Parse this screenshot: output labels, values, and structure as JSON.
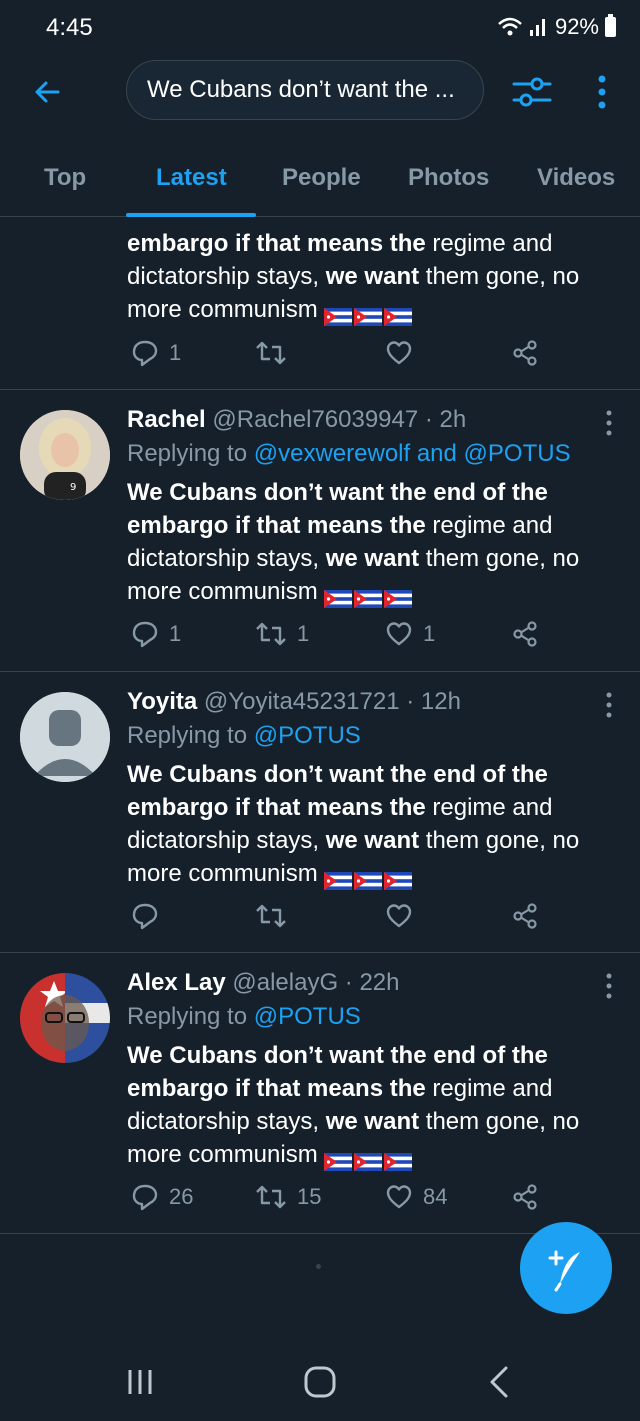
{
  "status_bar": {
    "time": "4:45",
    "battery": "92%"
  },
  "search": {
    "query": "We Cubans don’t want the ..."
  },
  "tabs": [
    "Top",
    "Latest",
    "People",
    "Photos",
    "Videos"
  ],
  "active_tab": "Latest",
  "partial_tweet": {
    "line1_bold": "embargo if that means the",
    "line1_rest": " regime and",
    "line2_a": "dictatorship stays, ",
    "line2_bold": "we want",
    "line2_rest": " them gone, no",
    "line3": "more communism",
    "replies": "1",
    "retweets": "",
    "likes": ""
  },
  "tweets": [
    {
      "name": "Rachel",
      "meta": "@Rachel76039947 · 2h",
      "replying_prefix": "Replying to ",
      "replying_to": "@vexwerewolf and @POTUS",
      "text_l1": "We Cubans don’t want the end of the",
      "text_l2_bold": "embargo if that means the",
      "text_l2_rest": " regime and",
      "text_l3_a": "dictatorship stays, ",
      "text_l3_bold": "we want",
      "text_l3_rest": " them gone, no",
      "text_l4": "more communism",
      "replies": "1",
      "retweets": "1",
      "likes": "1"
    },
    {
      "name": "Yoyita",
      "meta": "@Yoyita45231721 · 12h",
      "replying_prefix": "Replying to ",
      "replying_to": "@POTUS",
      "text_l1": "We Cubans don’t want the end of the",
      "text_l2_bold": "embargo if that means the",
      "text_l2_rest": " regime and",
      "text_l3_a": "dictatorship stays, ",
      "text_l3_bold": "we want",
      "text_l3_rest": " them gone, no",
      "text_l4": "more communism",
      "replies": "",
      "retweets": "",
      "likes": ""
    },
    {
      "name": "Alex Lay",
      "meta": "@alelayG · 22h",
      "replying_prefix": "Replying to ",
      "replying_to": "@POTUS",
      "text_l1": "We Cubans don’t want the end of the",
      "text_l2_bold": "embargo if that means the",
      "text_l2_rest": " regime and",
      "text_l3_a": "dictatorship stays, ",
      "text_l3_bold": "we want",
      "text_l3_rest": " them gone, no",
      "text_l4": "more communism",
      "replies": "26",
      "retweets": "15",
      "likes": "84"
    }
  ],
  "colors": {
    "background": "#15202b",
    "accent": "#1da1f2",
    "muted": "#8899a6",
    "divider": "#38444d"
  },
  "icons": [
    "back-arrow-icon",
    "filter-icon",
    "more-vertical-icon",
    "reply-icon",
    "retweet-icon",
    "like-icon",
    "share-icon",
    "compose-icon",
    "cuba-flag-icon"
  ]
}
